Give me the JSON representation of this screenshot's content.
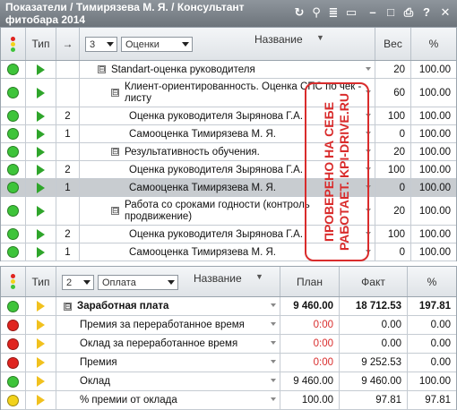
{
  "window": {
    "title": "Показатели / Тимирязева М. Я. / Консультант фитобара 2014",
    "controls": [
      "refresh-icon",
      "search-icon",
      "list-icon",
      "calendar-icon",
      "minimize-icon",
      "maximize-icon",
      "print-icon",
      "help-icon",
      "close-icon"
    ],
    "control_glyphs": {
      "refresh": "↻",
      "search": "⚲",
      "list": "≣",
      "calendar": "▭",
      "minimize": "–",
      "maximize": "□",
      "print": "⎙",
      "help": "?",
      "close": "✕"
    }
  },
  "top": {
    "header": {
      "type": "Тип",
      "arrow": "→",
      "level": "3",
      "filter": "Оценки",
      "name": "Название",
      "weight": "Вес",
      "percent": "%"
    },
    "rows": [
      {
        "status": "green",
        "indent": 1,
        "expander": "⊟",
        "name": "Standart-оценка руководителя",
        "weight": "20",
        "percent": "100.00"
      },
      {
        "status": "green",
        "indent": 2,
        "expander": "⊟",
        "name": "Клиент-ориентированность. Оценка СПС по чек - листу",
        "weight": "60",
        "percent": "100.00"
      },
      {
        "status": "green",
        "num": "2",
        "indent": 3,
        "name": "Оценка руководителя Зырянова Г.А.",
        "weight": "100",
        "percent": "100.00"
      },
      {
        "status": "green",
        "num": "1",
        "indent": 3,
        "name": "Самооценка Тимирязева М. Я.",
        "weight": "0",
        "percent": "100.00"
      },
      {
        "status": "green",
        "indent": 2,
        "expander": "⊟",
        "name": "Результативность обучения.",
        "weight": "20",
        "percent": "100.00"
      },
      {
        "status": "green",
        "num": "2",
        "indent": 3,
        "name": "Оценка руководителя Зырянова Г.А.",
        "weight": "100",
        "percent": "100.00"
      },
      {
        "status": "green",
        "num": "1",
        "indent": 3,
        "name": "Самооценка Тимирязева М. Я.",
        "weight": "0",
        "percent": "100.00",
        "selected": true
      },
      {
        "status": "green",
        "indent": 2,
        "expander": "⊟",
        "name": "Работа со сроками годности (контроль продвижение)",
        "weight": "20",
        "percent": "100.00"
      },
      {
        "status": "green",
        "num": "2",
        "indent": 3,
        "name": "Оценка руководителя Зырянова Г.А.",
        "weight": "100",
        "percent": "100.00"
      },
      {
        "status": "green",
        "num": "1",
        "indent": 3,
        "name": "Самооценка Тимирязева М. Я.",
        "weight": "0",
        "percent": "100.00"
      }
    ]
  },
  "stamp": {
    "text": "ПРОВЕРЕНО НА СЕБЕ РАБОТАЕТ. KPI-DRIVE.RU",
    "color": "#d92c2c"
  },
  "bottom": {
    "header": {
      "type": "Тип",
      "level": "2",
      "filter": "Оплата",
      "name": "Название",
      "plan": "План",
      "fact": "Факт",
      "percent": "%"
    },
    "rows": [
      {
        "status": "green",
        "expander": "⊟",
        "name": "Заработная плата",
        "plan": "9 460.00",
        "fact": "18 712.53",
        "percent": "197.81",
        "bold": true
      },
      {
        "status": "red",
        "name": "Премия за переработанное время",
        "plan": "0:00",
        "fact": "0.00",
        "percent": "0.00",
        "plan_red": true
      },
      {
        "status": "red",
        "name": "Оклад за переработанное время",
        "plan": "0:00",
        "fact": "0.00",
        "percent": "0.00",
        "plan_red": true
      },
      {
        "status": "red",
        "name": "Премия",
        "plan": "0:00",
        "fact": "9 252.53",
        "percent": "0.00",
        "plan_red": true
      },
      {
        "status": "green",
        "name": "Оклад",
        "plan": "9 460.00",
        "fact": "9 460.00",
        "percent": "100.00"
      },
      {
        "status": "yellow",
        "name": "% премии от оклада",
        "plan": "100.00",
        "fact": "97.81",
        "percent": "97.81"
      }
    ]
  },
  "colors": {
    "green": "#3ec43a",
    "red": "#e0241f",
    "yellow": "#f2d21b",
    "accent": "#d92c2c"
  }
}
